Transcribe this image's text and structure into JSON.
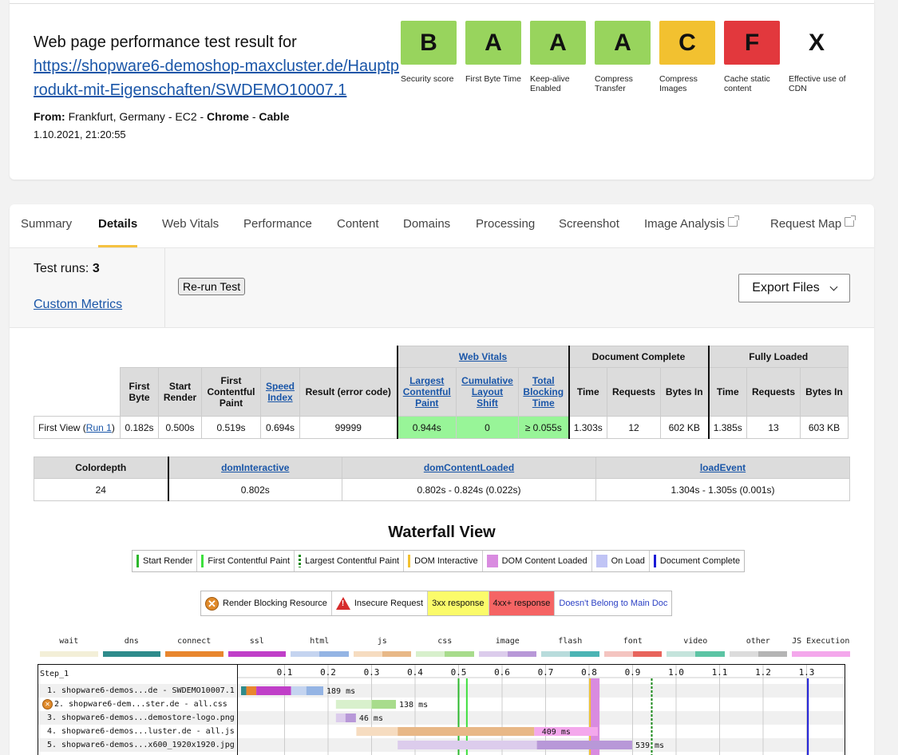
{
  "result": {
    "title_prefix": "Web page performance test result for",
    "url": "https://shopware6-demoshop-maxcluster.de/Hauptprodukt-mit-Eigenschaften/SWDEMO10007.1",
    "from_label": "From:",
    "location": "Frankfurt, Germany - EC2 - ",
    "browser": "Chrome",
    "sep": " - ",
    "connection": "Cable",
    "date": "1.10.2021, 21:20:55"
  },
  "grades": [
    {
      "grade": "B",
      "label": "Security score",
      "color": "#98d45d"
    },
    {
      "grade": "A",
      "label": "First Byte Time",
      "color": "#98d45d"
    },
    {
      "grade": "A",
      "label": "Keep-alive Enabled",
      "color": "#98d45d"
    },
    {
      "grade": "A",
      "label": "Compress Transfer",
      "color": "#98d45d"
    },
    {
      "grade": "C",
      "label": "Compress Images",
      "color": "#f2c130"
    },
    {
      "grade": "F",
      "label": "Cache static content",
      "color": "#e2383d"
    },
    {
      "grade": "X",
      "label": "Effective use of CDN",
      "color": "transparent"
    }
  ],
  "tabs": [
    {
      "label": "Summary"
    },
    {
      "label": "Details",
      "active": true
    },
    {
      "label": "Web Vitals"
    },
    {
      "label": "Performance"
    },
    {
      "label": "Content"
    },
    {
      "label": "Domains"
    },
    {
      "label": "Processing"
    },
    {
      "label": "Screenshot"
    },
    {
      "label": "Image Analysis",
      "external": true
    },
    {
      "label": "Request Map",
      "external": true
    }
  ],
  "runs": {
    "label": "Test runs:",
    "count": "3",
    "custom_metrics": "Custom Metrics",
    "rerun": "Re-run Test",
    "export": "Export Files"
  },
  "metrics": {
    "group_web_vitals": "Web Vitals",
    "group_doc_complete": "Document Complete",
    "group_fully_loaded": "Fully Loaded",
    "h_first_byte": "First Byte",
    "h_start_render": "Start Render",
    "h_fcp": "First Contentful Paint",
    "h_speed_index": "Speed Index",
    "h_result": "Result (error code)",
    "h_lcp": "Largest Contentful Paint",
    "h_cls": "Cumulative Layout Shift",
    "h_tbt": "Total Blocking Time",
    "h_time": "Time",
    "h_requests": "Requests",
    "h_bytes": "Bytes In",
    "row_label": "First View (",
    "row_link": "Run 1",
    "row_close": ")",
    "first_byte": "0.182s",
    "start_render": "0.500s",
    "fcp": "0.519s",
    "speed_index": "0.694s",
    "result": "99999",
    "lcp": "0.944s",
    "cls": "0",
    "tbt": "≥ 0.055s",
    "dc_time": "1.303s",
    "dc_requests": "12",
    "dc_bytes": "602 KB",
    "fl_time": "1.385s",
    "fl_requests": "13",
    "fl_bytes": "603 KB"
  },
  "custom": {
    "h_colordepth": "Colordepth",
    "h_dom_interactive": "domInteractive",
    "h_dom_content_loaded": "domContentLoaded",
    "h_load_event": "loadEvent",
    "colordepth": "24",
    "dom_interactive": "0.802s",
    "dom_content_loaded": "0.802s - 0.824s (0.022s)",
    "load_event": "1.304s - 1.305s (0.001s)"
  },
  "waterfall": {
    "title": "Waterfall View",
    "legend1": [
      {
        "label": "Start Render",
        "color": "#2cb82c",
        "kind": "line"
      },
      {
        "label": "First Contentful Paint",
        "color": "#3de03d",
        "kind": "line"
      },
      {
        "label": "Largest Contentful Paint",
        "color": "#1a8a1a",
        "kind": "dash"
      },
      {
        "label": "DOM Interactive",
        "color": "#f2c130",
        "kind": "line"
      },
      {
        "label": "DOM Content Loaded",
        "color": "#d98be0",
        "kind": "box"
      },
      {
        "label": "On Load",
        "color": "#c0c4f5",
        "kind": "box"
      },
      {
        "label": "Document Complete",
        "color": "#1a1ad6",
        "kind": "line"
      }
    ],
    "legend2": {
      "render_blocking": "Render Blocking Resource",
      "insecure": "Insecure Request",
      "r3xx": "3xx response",
      "r4xx": "4xx+ response",
      "not_main": "Doesn't Belong to Main Doc"
    },
    "types": [
      {
        "name": "wait",
        "c1": "#f3efd8",
        "c2": "#f3efd8"
      },
      {
        "name": "dns",
        "c1": "#2e8b8b",
        "c2": "#2e8b8b"
      },
      {
        "name": "connect",
        "c1": "#e8862e",
        "c2": "#e8862e"
      },
      {
        "name": "ssl",
        "c1": "#c03fc8",
        "c2": "#c03fc8"
      },
      {
        "name": "html",
        "c1": "#c4d4f0",
        "c2": "#94b4e4"
      },
      {
        "name": "js",
        "c1": "#f6dcc0",
        "c2": "#e8b887"
      },
      {
        "name": "css",
        "c1": "#d8f0cc",
        "c2": "#a8dc8c"
      },
      {
        "name": "image",
        "c1": "#dcccec",
        "c2": "#b898d8"
      },
      {
        "name": "flash",
        "c1": "#b8dcdc",
        "c2": "#4cb4b4"
      },
      {
        "name": "font",
        "c1": "#f4c4c0",
        "c2": "#e8645c"
      },
      {
        "name": "video",
        "c1": "#c4e4dc",
        "c2": "#5cc4a4"
      },
      {
        "name": "other",
        "c1": "#dcdcdc",
        "c2": "#b4b4b4"
      },
      {
        "name": "JS Execution",
        "c1": "#f4a8ec",
        "c2": "#f4a8ec"
      }
    ],
    "step": "Step_1",
    "ticks": [
      "0.1",
      "0.2",
      "0.3",
      "0.4",
      "0.5",
      "0.6",
      "0.7",
      "0.8",
      "0.9",
      "1.0",
      "1.1",
      "1.2",
      "1.3"
    ],
    "requests": [
      {
        "label": "1. shopware6-demos...de - SWDEMO10007.1",
        "ms": "189 ms",
        "blocking": false
      },
      {
        "label": "2. shopware6-dem...ster.de - all.css",
        "ms": "138 ms",
        "blocking": true
      },
      {
        "label": "3. shopware6-demos...demostore-logo.png",
        "ms": "46 ms",
        "blocking": false
      },
      {
        "label": "4. shopware6-demos...luster.de - all.js",
        "ms": "409 ms",
        "blocking": false
      },
      {
        "label": "5. shopware6-demos...x600_1920x1920.jpg",
        "ms": "539 ms",
        "blocking": false
      }
    ],
    "bars": [
      {
        "segments": [
          {
            "start": 0.0,
            "end": 0.012,
            "color": "#2e8b8b"
          },
          {
            "start": 0.012,
            "end": 0.035,
            "color": "#e8862e"
          },
          {
            "start": 0.035,
            "end": 0.115,
            "color": "#c03fc8"
          },
          {
            "start": 0.115,
            "end": 0.15,
            "color": "#c4d4f0"
          },
          {
            "start": 0.15,
            "end": 0.189,
            "color": "#94b4e4"
          }
        ]
      },
      {
        "segments": [
          {
            "start": 0.218,
            "end": 0.3,
            "color": "#d8f0cc"
          },
          {
            "start": 0.3,
            "end": 0.356,
            "color": "#a8dc8c"
          }
        ]
      },
      {
        "segments": [
          {
            "start": 0.218,
            "end": 0.24,
            "color": "#dcccec"
          },
          {
            "start": 0.24,
            "end": 0.264,
            "color": "#b898d8"
          }
        ]
      },
      {
        "segments": [
          {
            "start": 0.265,
            "end": 0.36,
            "color": "#f6dcc0"
          },
          {
            "start": 0.36,
            "end": 0.674,
            "color": "#e8b887"
          },
          {
            "start": 0.674,
            "end": 0.82,
            "color": "#f4a8ec"
          }
        ]
      },
      {
        "segments": [
          {
            "start": 0.36,
            "end": 0.68,
            "color": "#dcccec"
          },
          {
            "start": 0.68,
            "end": 0.899,
            "color": "#b898d8"
          }
        ]
      }
    ],
    "markers": {
      "start_render": 0.5,
      "fcp": 0.519,
      "lcp": 0.944,
      "dom_interactive": 0.802,
      "dcl_start": 0.802,
      "dcl_end": 0.824,
      "doc_complete": 1.303
    }
  }
}
